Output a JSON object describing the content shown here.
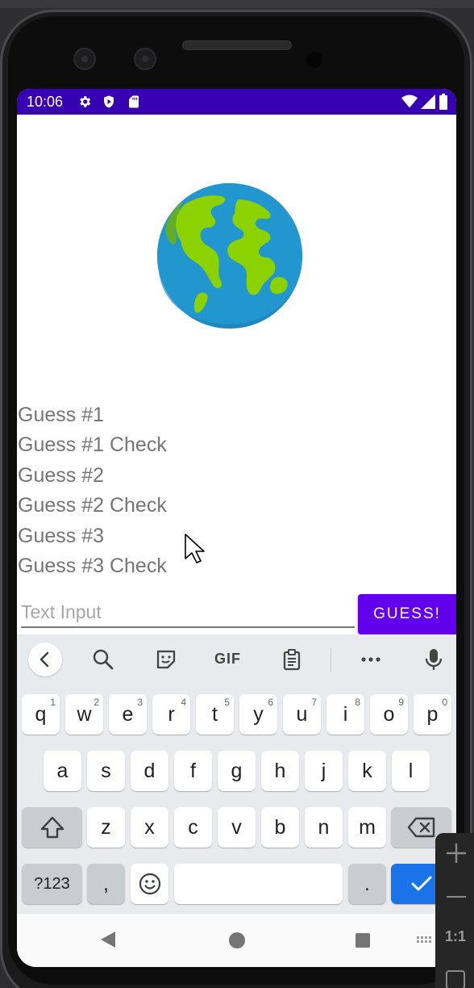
{
  "status_bar": {
    "time": "10:06"
  },
  "guesses": [
    "Guess #1",
    "Guess #1 Check",
    "Guess #2",
    "Guess #2 Check",
    "Guess #3",
    "Guess #3 Check"
  ],
  "input": {
    "placeholder": "Text Input",
    "value": ""
  },
  "guess_button": {
    "label": "GUESS!"
  },
  "keyboard": {
    "toolbar": {
      "gif_label": "GIF"
    },
    "row1": [
      {
        "k": "q",
        "h": "1"
      },
      {
        "k": "w",
        "h": "2"
      },
      {
        "k": "e",
        "h": "3"
      },
      {
        "k": "r",
        "h": "4"
      },
      {
        "k": "t",
        "h": "5"
      },
      {
        "k": "y",
        "h": "6"
      },
      {
        "k": "u",
        "h": "7"
      },
      {
        "k": "i",
        "h": "8"
      },
      {
        "k": "o",
        "h": "9"
      },
      {
        "k": "p",
        "h": "0"
      }
    ],
    "row2": [
      "a",
      "s",
      "d",
      "f",
      "g",
      "h",
      "j",
      "k",
      "l"
    ],
    "row3": [
      "z",
      "x",
      "c",
      "v",
      "b",
      "n",
      "m"
    ],
    "symbols_label": "?123",
    "comma_label": ",",
    "period_label": "."
  },
  "side_panel": {
    "ratio_label": "1:1"
  },
  "colors": {
    "status_bar": "#3700b3",
    "accent": "#6200ee",
    "enter_key": "#1a73e8"
  }
}
